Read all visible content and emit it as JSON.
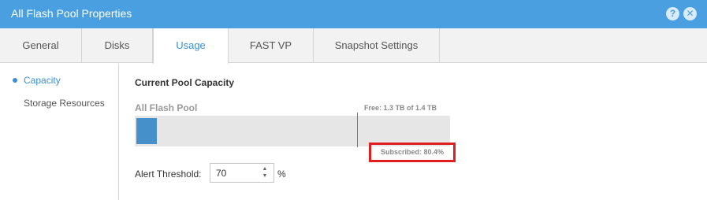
{
  "window": {
    "title": "All Flash Pool Properties",
    "help_icon": "?",
    "close_icon": "✕"
  },
  "tabs": [
    {
      "label": "General"
    },
    {
      "label": "Disks"
    },
    {
      "label": "Usage",
      "active": true
    },
    {
      "label": "FAST VP"
    },
    {
      "label": "Snapshot Settings"
    }
  ],
  "sidebar": {
    "items": [
      {
        "label": "Capacity",
        "active": true
      },
      {
        "label": "Storage Resources"
      }
    ]
  },
  "capacity": {
    "section_title": "Current Pool Capacity",
    "pool_name": "All Flash Pool",
    "free_text": "Free: 1.3 TB of 1.4 TB",
    "subscribed_text": "Subscribed: 80.4%",
    "used_fraction": 0.07,
    "subscribed_fraction": 0.704
  },
  "alert": {
    "label": "Alert Threshold:",
    "value": "70",
    "unit": "%",
    "up_icon": "▲",
    "down_icon": "▼"
  },
  "colors": {
    "titlebar": "#4a9fe0",
    "accent": "#3a8fd6",
    "bar_fill": "#4590cb",
    "marker": "#e04a3c",
    "highlight_box": "#e02020"
  }
}
